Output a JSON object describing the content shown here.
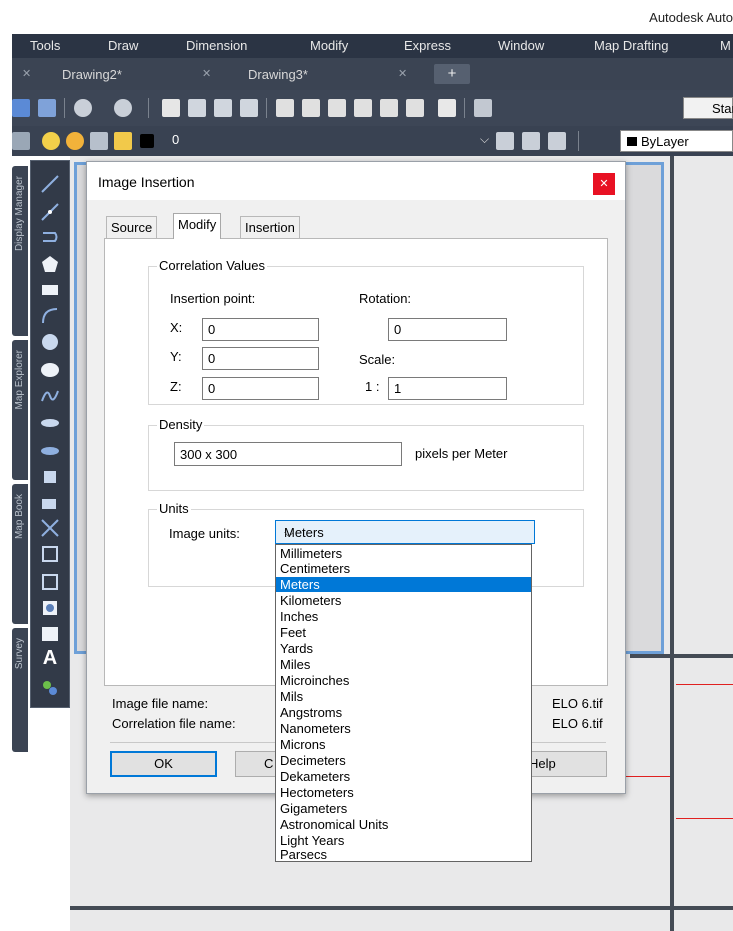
{
  "app": {
    "title": "Autodesk Auto"
  },
  "menu": [
    "Tools",
    "Draw",
    "Dimension",
    "Modify",
    "Express",
    "Window",
    "Map Drafting",
    "M"
  ],
  "doc_tabs": [
    "Drawing2*",
    "Drawing3*"
  ],
  "toolbar": {
    "style_label": "Stan",
    "layer_name": "0",
    "color_label": "ByLayer"
  },
  "side_tabs": [
    "Display Manager",
    "Map Explorer",
    "Map Book",
    "Survey"
  ],
  "dialog": {
    "title": "Image Insertion",
    "tabs": [
      "Source",
      "Modify",
      "Insertion"
    ],
    "correlation": {
      "legend": "Correlation Values",
      "insertion_point_label": "Insertion point:",
      "x_label": "X:",
      "x_value": "0",
      "y_label": "Y:",
      "y_value": "0",
      "z_label": "Z:",
      "z_value": "0",
      "rotation_label": "Rotation:",
      "rotation_value": "0",
      "scale_label": "Scale:",
      "scale_prefix": "1 :",
      "scale_value": "1"
    },
    "density": {
      "legend": "Density",
      "value": "300 x 300",
      "unit_label": "pixels per Meter"
    },
    "units": {
      "legend": "Units",
      "image_units_label": "Image units:",
      "selected": "Meters",
      "options": [
        "Millimeters",
        "Centimeters",
        "Meters",
        "Kilometers",
        "Inches",
        "Feet",
        "Yards",
        "Miles",
        "Microinches",
        "Mils",
        "Angstroms",
        "Nanometers",
        "Microns",
        "Decimeters",
        "Dekameters",
        "Hectometers",
        "Gigameters",
        "Astronomical Units",
        "Light Years",
        "Parsecs"
      ]
    },
    "files": {
      "image_file_label": "Image file name:",
      "image_file_value": "ELO 6.tif",
      "correlation_file_label": "Correlation file name:",
      "correlation_file_value": "ELO 6.tif"
    },
    "buttons": {
      "ok": "OK",
      "cancel_partial": "C",
      "help": "Help"
    }
  },
  "colors": {
    "accent": "#0078d7",
    "close": "#e81123",
    "menubar": "#2b3444"
  }
}
